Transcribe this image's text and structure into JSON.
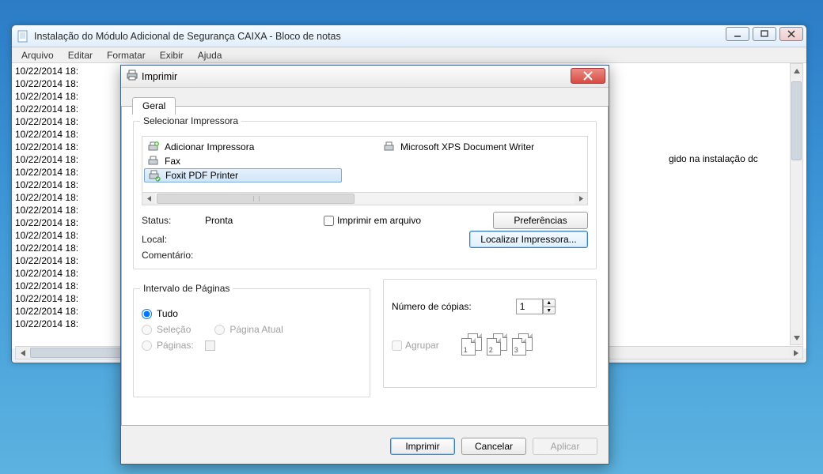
{
  "notepad": {
    "title": "Instalação do Módulo Adicional de Segurança CAIXA - Bloco de notas",
    "menu": [
      "Arquivo",
      "Editar",
      "Formatar",
      "Exibir",
      "Ajuda"
    ],
    "line_prefix": "10/22/2014 18",
    "line_count": 21,
    "partial_right_text": "gido na instalação dc"
  },
  "dialog": {
    "title": "Imprimir",
    "tab": "Geral",
    "group_select_printer": "Selecionar Impressora",
    "printers": {
      "add": "Adicionar Impressora",
      "fax": "Fax",
      "foxit": "Foxit PDF Printer",
      "xps": "Microsoft XPS Document Writer"
    },
    "status_label": "Status:",
    "status_value": "Pronta",
    "local_label": "Local:",
    "comment_label": "Comentário:",
    "print_to_file": "Imprimir em arquivo",
    "preferences": "Preferências",
    "find_printer": "Localizar Impressora...",
    "group_page_range": "Intervalo de Páginas",
    "range_all": "Tudo",
    "range_selection": "Seleção",
    "range_current": "Página Atual",
    "range_pages": "Páginas:",
    "copies_label": "Número de cópias:",
    "copies_value": "1",
    "collate": "Agrupar",
    "btn_print": "Imprimir",
    "btn_cancel": "Cancelar",
    "btn_apply": "Aplicar"
  }
}
